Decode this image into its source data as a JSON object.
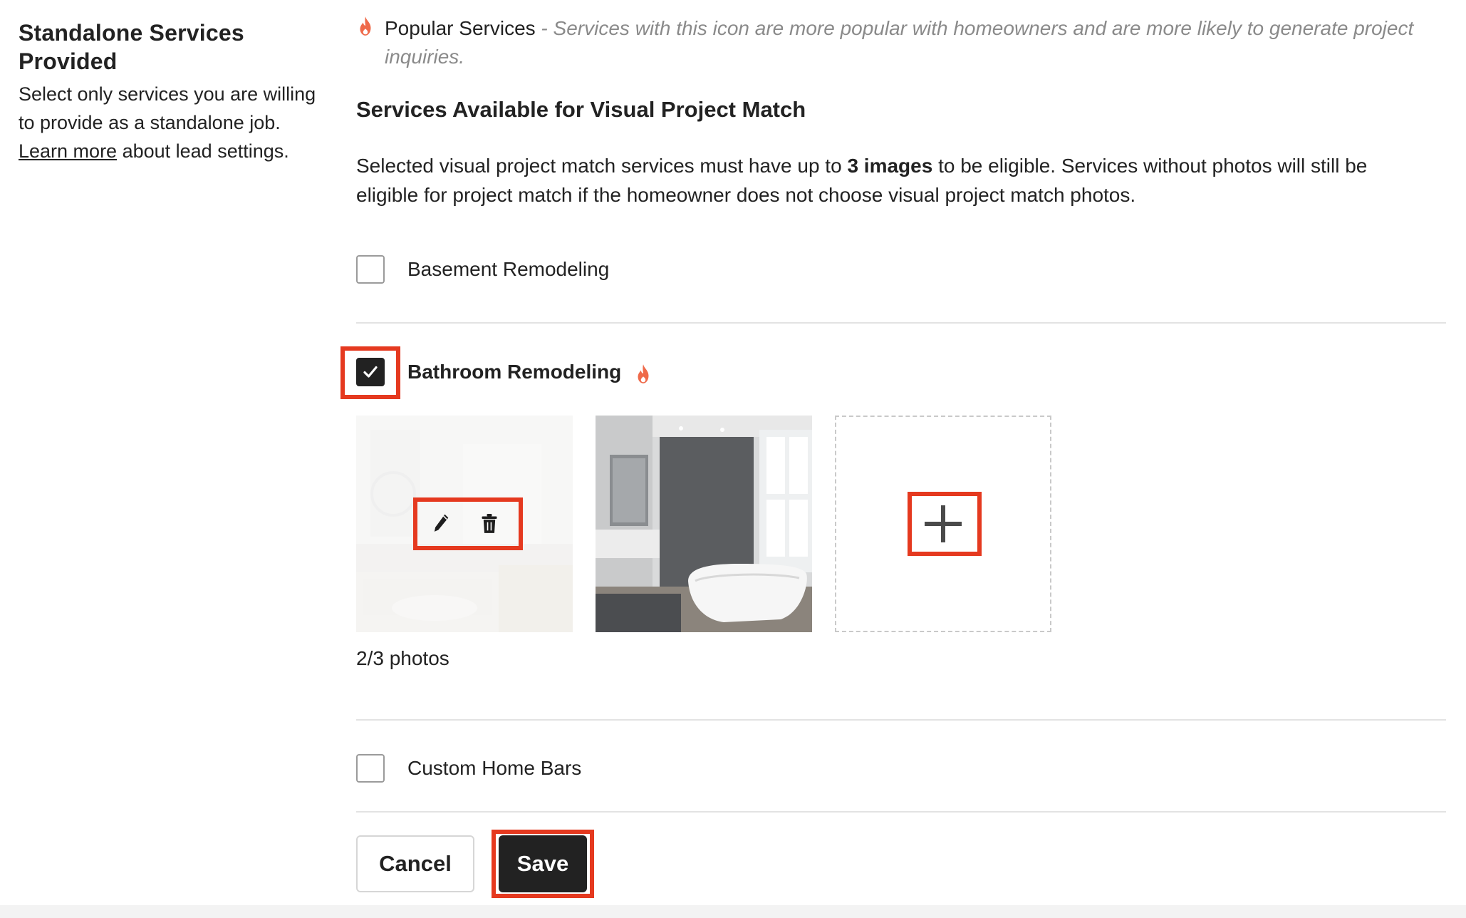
{
  "left": {
    "title": "Standalone Services Provided",
    "desc_before": "Select only services you are willing to provide as a standalone job. ",
    "learn_more": "Learn more",
    "desc_after": " about lead settings."
  },
  "popular": {
    "icon": "flame-icon",
    "label": "Popular Services",
    "separator": " - ",
    "note": "Services with this icon are more popular with homeowners and are more likely to generate project inquiries."
  },
  "section": {
    "title": "Services Available for Visual Project Match",
    "desc_before": "Selected visual project match services must have up to ",
    "desc_bold": "3 images",
    "desc_after": " to be eligible. Services without photos will still be eligible for project match if the homeowner does not choose visual project match photos."
  },
  "services": [
    {
      "label": "Basement Remodeling",
      "checked": false,
      "popular": false
    },
    {
      "label": "Bathroom Remodeling",
      "checked": true,
      "popular": true
    },
    {
      "label": "Custom Home Bars",
      "checked": false,
      "popular": false
    }
  ],
  "photos": {
    "count_label": "2/3 photos",
    "items": [
      {
        "name": "bathroom-photo-1",
        "state": "hover-actions"
      },
      {
        "name": "bathroom-photo-2",
        "state": "normal"
      }
    ],
    "add_icon": "plus-icon"
  },
  "buttons": {
    "cancel": "Cancel",
    "save": "Save"
  },
  "colors": {
    "highlight": "#e5391f",
    "flame": "#ef6a4a",
    "dark": "#222222"
  }
}
